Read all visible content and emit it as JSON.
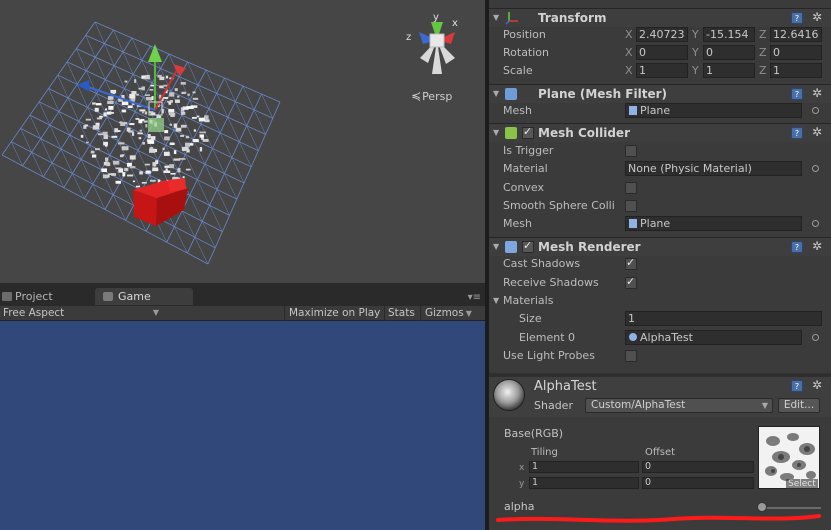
{
  "scene": {
    "projection_label": "Persp",
    "gizmo_axes": [
      "y",
      "x",
      "z"
    ]
  },
  "game_tabs": [
    "Project",
    "Game"
  ],
  "game_toolbar": {
    "aspect": "Free Aspect",
    "maximize": "Maximize on Play",
    "stats": "Stats",
    "gizmos": "Gizmos"
  },
  "inspector": {
    "transform": {
      "title": "Transform",
      "position": {
        "label": "Position",
        "x": "2.40723",
        "y": "-15.154",
        "z": "12.6416"
      },
      "rotation": {
        "label": "Rotation",
        "x": "0",
        "y": "0",
        "z": "0"
      },
      "scale": {
        "label": "Scale",
        "x": "1",
        "y": "1",
        "z": "1"
      },
      "axes": [
        "X",
        "Y",
        "Z"
      ]
    },
    "mesh_filter": {
      "title": "Plane (Mesh Filter)",
      "mesh_label": "Mesh",
      "mesh_value": "Plane"
    },
    "mesh_collider": {
      "title": "Mesh Collider",
      "is_trigger": {
        "label": "Is Trigger",
        "checked": false
      },
      "material": {
        "label": "Material",
        "value": "None (Physic Material)"
      },
      "convex": {
        "label": "Convex",
        "checked": false
      },
      "smooth": {
        "label": "Smooth Sphere Colli",
        "checked": false
      },
      "mesh": {
        "label": "Mesh",
        "value": "Plane"
      }
    },
    "mesh_renderer": {
      "title": "Mesh Renderer",
      "cast_shadows": {
        "label": "Cast Shadows",
        "checked": true
      },
      "receive_shadows": {
        "label": "Receive Shadows",
        "checked": true
      },
      "materials_label": "Materials",
      "size": {
        "label": "Size",
        "value": "1"
      },
      "element0": {
        "label": "Element 0",
        "value": "AlphaTest"
      },
      "light_probes": {
        "label": "Use Light Probes",
        "checked": false
      }
    },
    "material": {
      "name": "AlphaTest",
      "shader_label": "Shader",
      "shader_value": "Custom/AlphaTest",
      "edit_label": "Edit...",
      "base_label": "Base(RGB)",
      "tiling_label": "Tiling",
      "offset_label": "Offset",
      "tiling_x": "1",
      "tiling_y": "1",
      "offset_x": "0",
      "offset_y": "0",
      "x_label": "x",
      "y_label": "y",
      "select_label": "Select",
      "alpha_label": "alpha",
      "alpha_value": 0.0
    }
  },
  "colors": {
    "game_bg": "#31497a",
    "scene_bg": "#464646",
    "inspector_bg": "#3b3b3b",
    "annotation": "#ff1a1a"
  }
}
